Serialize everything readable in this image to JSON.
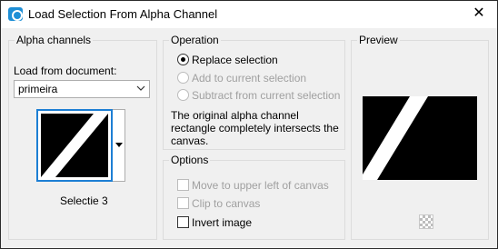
{
  "window": {
    "title": "Load Selection From Alpha Channel",
    "close_glyph": "✕"
  },
  "alpha_channels": {
    "group_label": "Alpha channels",
    "load_from_label": "Load from document:",
    "document_value": "primeira",
    "selected_channel": "Selectie 3"
  },
  "operation": {
    "group_label": "Operation",
    "options": [
      {
        "label": "Replace selection",
        "checked": true,
        "enabled": true
      },
      {
        "label": "Add to current selection",
        "checked": false,
        "enabled": false
      },
      {
        "label": "Subtract from current selection",
        "checked": false,
        "enabled": false
      }
    ],
    "description": "The original alpha channel rectangle completely intersects the canvas."
  },
  "options": {
    "group_label": "Options",
    "items": [
      {
        "label": "Move to upper left of canvas",
        "checked": false,
        "enabled": false
      },
      {
        "label": "Clip to canvas",
        "checked": false,
        "enabled": false
      },
      {
        "label": "Invert image",
        "checked": false,
        "enabled": true
      }
    ]
  },
  "preview": {
    "group_label": "Preview",
    "icon": "checkerboard-icon"
  },
  "colors": {
    "selection_border": "#1d7fd4",
    "group_border": "#dcdcdc",
    "dialog_bg": "#f0f0f0"
  }
}
